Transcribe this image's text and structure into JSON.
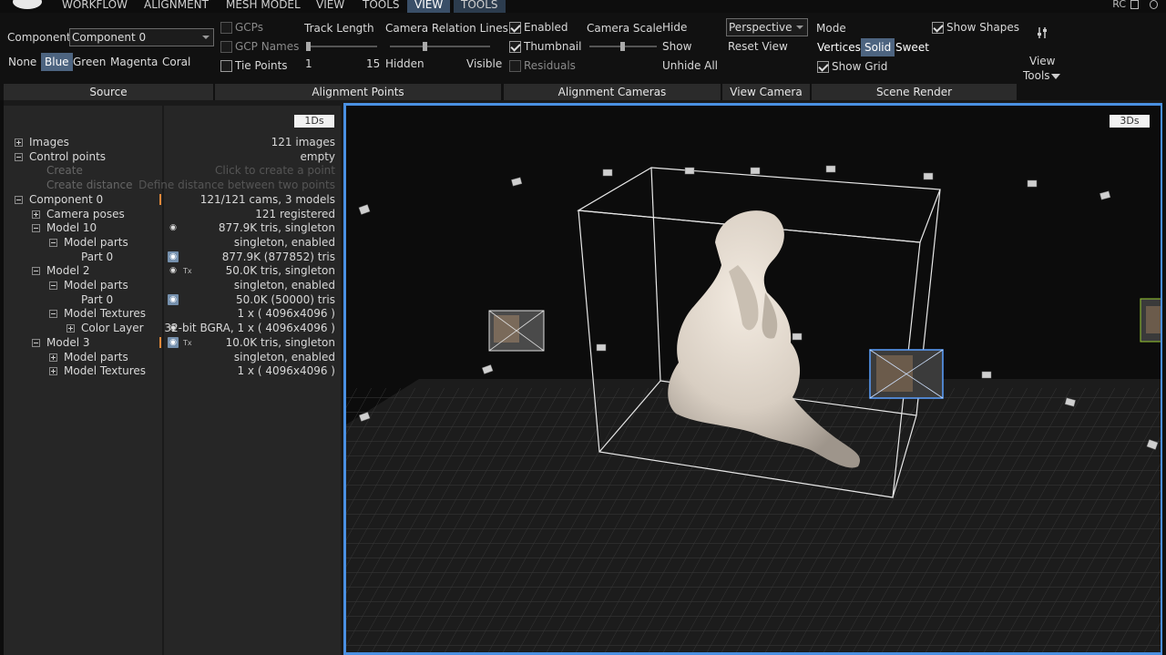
{
  "menu": {
    "items": [
      "WORKFLOW",
      "ALIGNMENT",
      "MESH MODEL",
      "VIEW",
      "TOOLS",
      "VIEW",
      "TOOLS"
    ],
    "rc": "RC"
  },
  "source": {
    "component_label": "Component",
    "component_value": "Component 0",
    "colors": [
      "None",
      "Blue",
      "Green",
      "Magenta",
      "Coral"
    ],
    "selected_color": "Blue",
    "footer": "Source"
  },
  "alignment_points": {
    "gcps": "GCPs",
    "gcp_names": "GCP Names",
    "tie_points": "Tie Points",
    "track_length_label": "Track Length",
    "track_min": "1",
    "track_max": "15",
    "relation_label": "Camera Relation Lines",
    "relation_min": "Hidden",
    "relation_max": "Visible",
    "footer": "Alignment Points"
  },
  "alignment_cameras": {
    "enabled": "Enabled",
    "thumbnail": "Thumbnail",
    "residuals": "Residuals",
    "scale_label": "Camera Scale",
    "hide": "Hide",
    "show": "Show",
    "unhide_all": "Unhide All",
    "footer": "Alignment Cameras"
  },
  "view_camera": {
    "projection": "Perspective",
    "reset": "Reset View",
    "footer": "View Camera"
  },
  "scene_render": {
    "mode_label": "Mode",
    "modes": [
      "Vertices",
      "Solid",
      "Sweet"
    ],
    "selected_mode": "Solid",
    "show_grid": "Show Grid",
    "show_shapes": "Show Shapes",
    "footer": "Scene Render"
  },
  "view_tools": {
    "label_1": "View",
    "label_2": "Tools"
  },
  "panel": {
    "tag": "1Ds",
    "rows": [
      {
        "name": "Images",
        "value": "121 images",
        "indent": 0,
        "exp": "plus"
      },
      {
        "name": "Control points",
        "value": "empty",
        "indent": 0,
        "exp": "minus"
      },
      {
        "name": "Create",
        "value": "Click to create a point",
        "indent": 1,
        "exp": "none",
        "dim": true
      },
      {
        "name": "Create distance",
        "value": "Define distance between two points",
        "indent": 1,
        "exp": "none",
        "dim": true
      },
      {
        "name": "Component 0",
        "value": "121/121 cams, 3 models",
        "indent": 0,
        "exp": "minus",
        "mark": true
      },
      {
        "name": "Camera poses",
        "value": "121 registered",
        "indent": 1,
        "exp": "plus"
      },
      {
        "name": "Model 10",
        "value": "877.9K tris, singleton",
        "indent": 1,
        "exp": "minus",
        "eye": "plain"
      },
      {
        "name": "Model parts",
        "value": "singleton, enabled",
        "indent": 2,
        "exp": "minus"
      },
      {
        "name": "Part 0",
        "value": "877.9K (877852) tris",
        "indent": 3,
        "exp": "none",
        "eye": "boxed"
      },
      {
        "name": "Model 2",
        "value": "50.0K tris, singleton",
        "indent": 1,
        "exp": "minus",
        "eye": "plain",
        "tex": "Tx"
      },
      {
        "name": "Model parts",
        "value": "singleton, enabled",
        "indent": 2,
        "exp": "minus"
      },
      {
        "name": "Part 0",
        "value": "50.0K (50000) tris",
        "indent": 3,
        "exp": "none",
        "eye": "boxed"
      },
      {
        "name": "Model Textures",
        "value": "1 x ( 4096x4096 )",
        "indent": 2,
        "exp": "minus"
      },
      {
        "name": "Color Layer",
        "value": "32-bit BGRA, 1 x ( 4096x4096 )",
        "indent": 3,
        "exp": "plus",
        "eye": "plain"
      },
      {
        "name": "Model 3",
        "value": "10.0K tris, singleton",
        "indent": 1,
        "exp": "minus",
        "eye": "boxed",
        "tex": "Tx",
        "mark": true
      },
      {
        "name": "Model parts",
        "value": "singleton, enabled",
        "indent": 2,
        "exp": "plus"
      },
      {
        "name": "Model Textures",
        "value": "1 x ( 4096x4096 )",
        "indent": 2,
        "exp": "plus"
      }
    ]
  },
  "viewport": {
    "tag": "3Ds"
  },
  "colors": {
    "accent": "#4a90e2",
    "selected": "#4d6480",
    "mark": "#e0883a"
  }
}
